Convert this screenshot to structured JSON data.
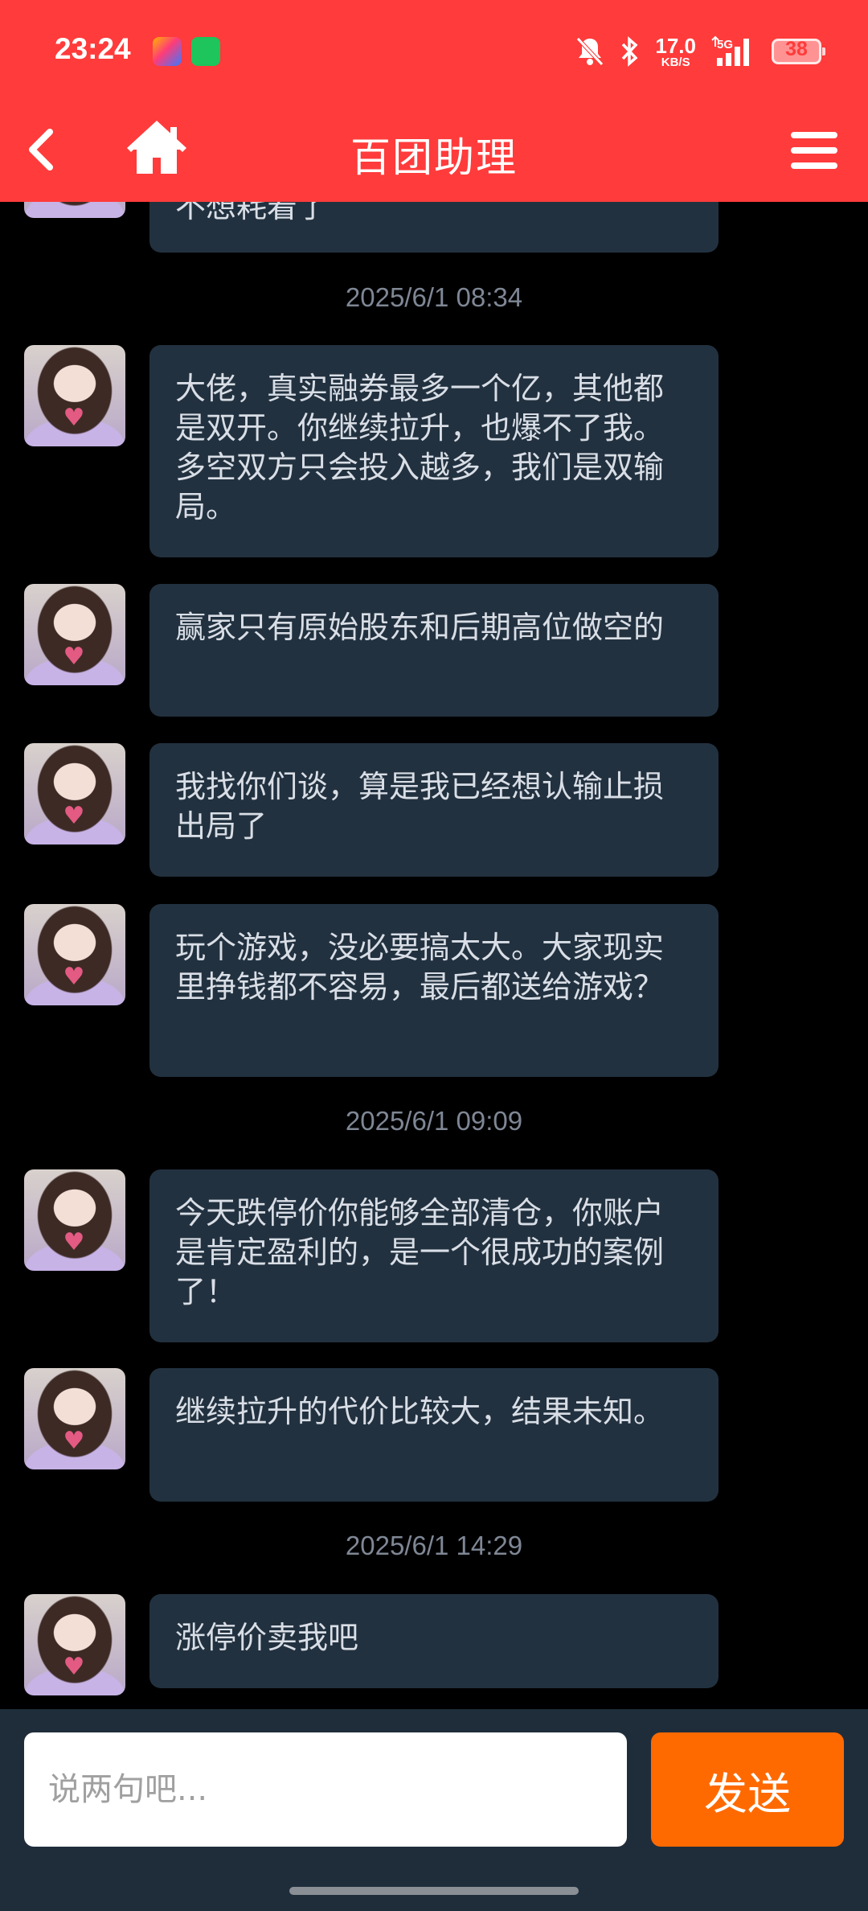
{
  "status": {
    "time": "23:24",
    "speed_value": "17.0",
    "speed_unit": "KB/S",
    "network": "5G",
    "battery": "38"
  },
  "header": {
    "title": "百团助理",
    "back_icon": "back-icon",
    "home_icon": "home-icon",
    "menu_icon": "menu-icon"
  },
  "messages": {
    "partial_top": "不想耗着了",
    "ts1": "2025/6/1 08:34",
    "m1": "大佬，真实融券最多一个亿，其他都是双开。你继续拉升，也爆不了我。多空双方只会投入越多，我们是双输局。",
    "m2": "赢家只有原始股东和后期高位做空的",
    "m3": "我找你们谈，算是我已经想认输止损出局了",
    "m4": "玩个游戏，没必要搞太大。大家现实里挣钱都不容易，最后都送给游戏？",
    "ts2": "2025/6/1 09:09",
    "m5": "今天跌停价你能够全部清仓，你账户是肯定盈利的，是一个很成功的案例了！",
    "m6": "继续拉升的代价比较大，结果未知。",
    "ts3": "2025/6/1 14:29",
    "m7": "涨停价卖我吧"
  },
  "input": {
    "placeholder": "说两句吧...",
    "send_label": "发送"
  },
  "colors": {
    "header": "#ff3b3b",
    "bubble": "#22313f",
    "send": "#ff6a00"
  }
}
